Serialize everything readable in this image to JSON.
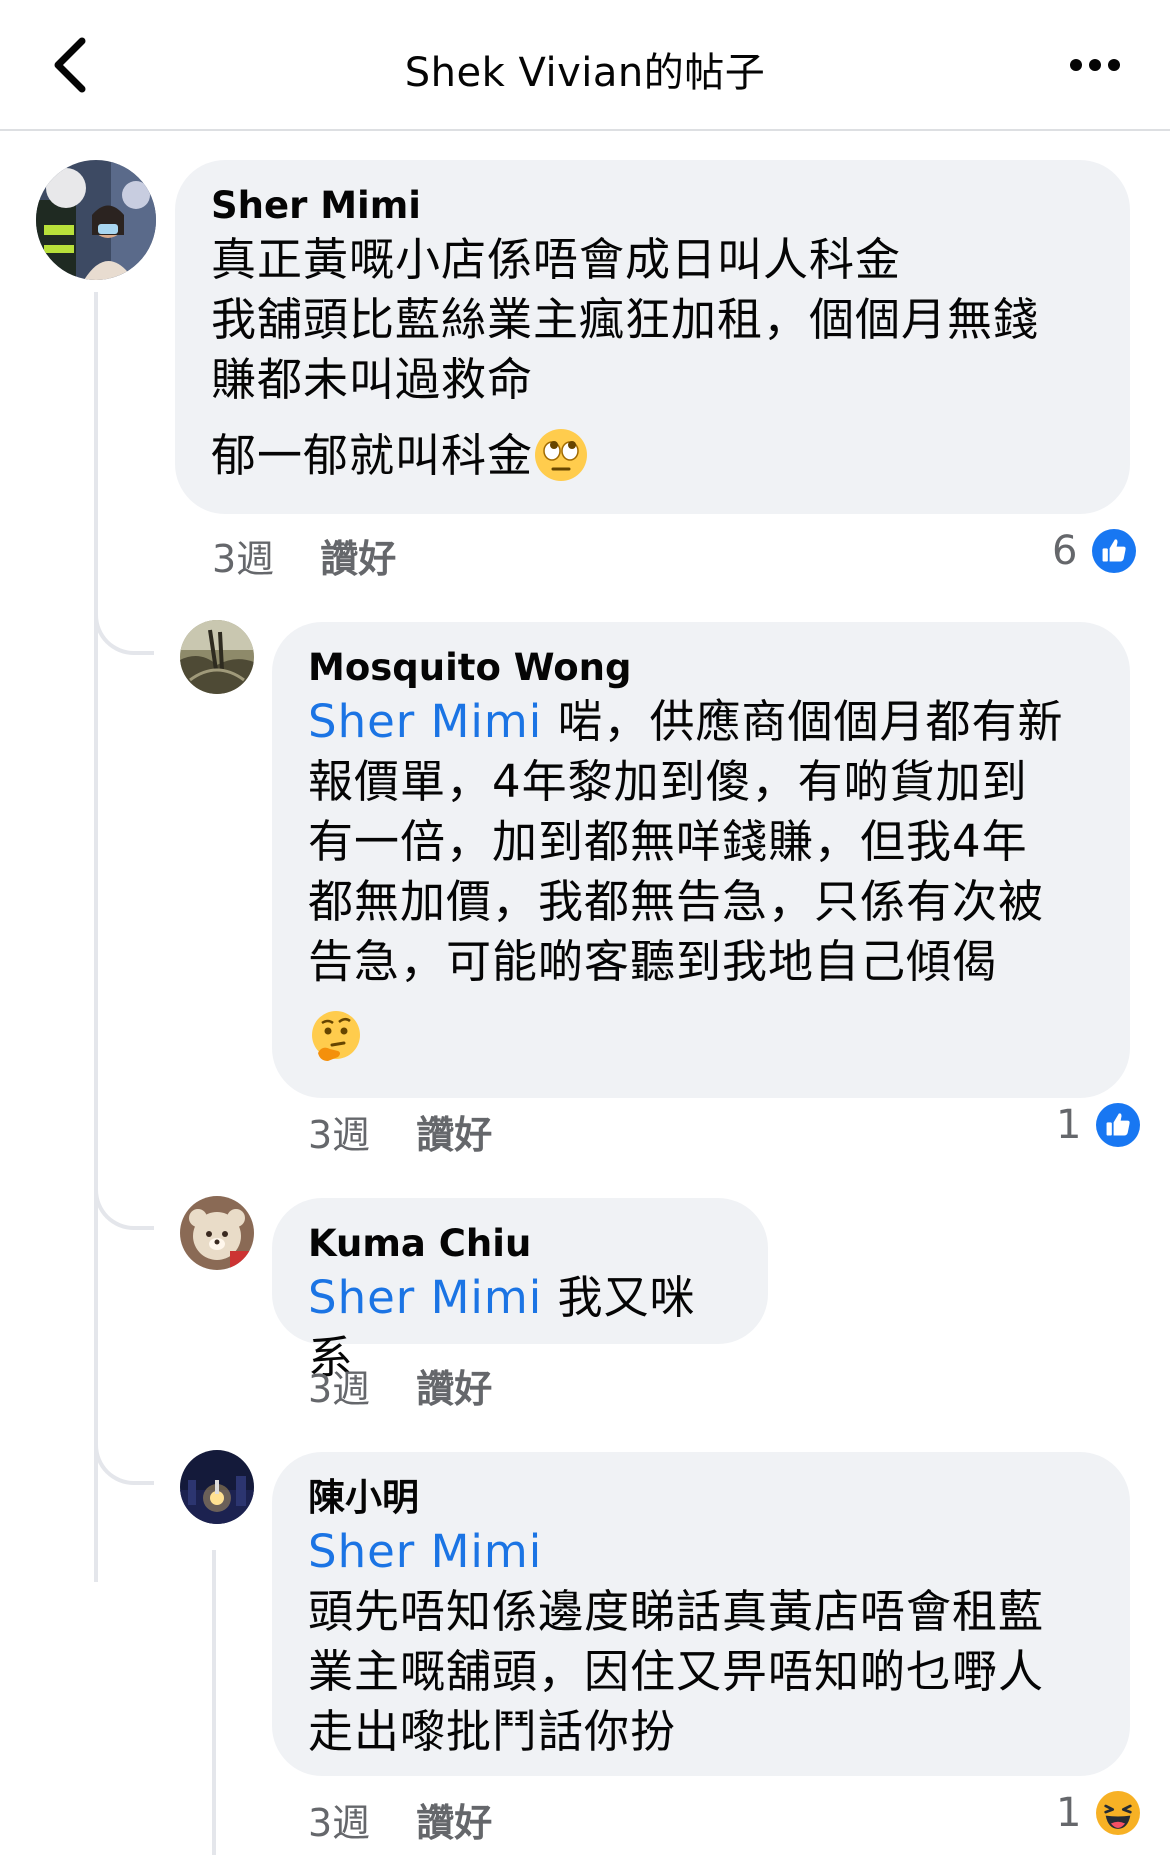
{
  "header": {
    "title": "Shek Vivian的帖子"
  },
  "comments": [
    {
      "author": "Sher Mimi",
      "lines": [
        "真正黃嘅小店係唔會成日叫人科金",
        "我舖頭比藍絲業主瘋狂加租，個個月無錢",
        "賺都未叫過救命"
      ],
      "line2": "郁一郁就叫科金",
      "line2_emoji": "face-with-rolling-eyes",
      "time": "3週",
      "like_label": "讚好",
      "reaction_count": "6",
      "reaction_type": "like"
    },
    {
      "author": "Mosquito Wong",
      "mention": "Sher Mimi",
      "lines": [
        " 啱，供應商個個月都有新",
        "報價單，4年黎加到傻，有啲貨加到",
        "有一倍，加到都無咩錢賺，但我4年",
        "都無加價，我都無告急，只係有次被",
        "告急，可能啲客聽到我地自己傾偈"
      ],
      "trailing_emoji": "thinking-face",
      "time": "3週",
      "like_label": "讚好",
      "reaction_count": "1",
      "reaction_type": "like"
    },
    {
      "author": "Kuma Chiu",
      "mention": "Sher Mimi",
      "text": " 我又咪系",
      "time": "3週",
      "like_label": "讚好"
    },
    {
      "author": "陳小明",
      "mention": "Sher Mimi",
      "lines": [
        "頭先唔知係邊度睇話真黃店唔會租藍",
        "業主嘅舖頭，因住又畀唔知啲乜嘢人",
        "走出嚟批鬥話你扮"
      ],
      "time": "3週",
      "like_label": "讚好",
      "reaction_count": "1",
      "reaction_type": "haha"
    }
  ],
  "colors": {
    "mention": "#1b74e4",
    "bubble": "#f0f2f5",
    "like_blue": "#1877f2",
    "haha_yellow": "#f7b125"
  }
}
